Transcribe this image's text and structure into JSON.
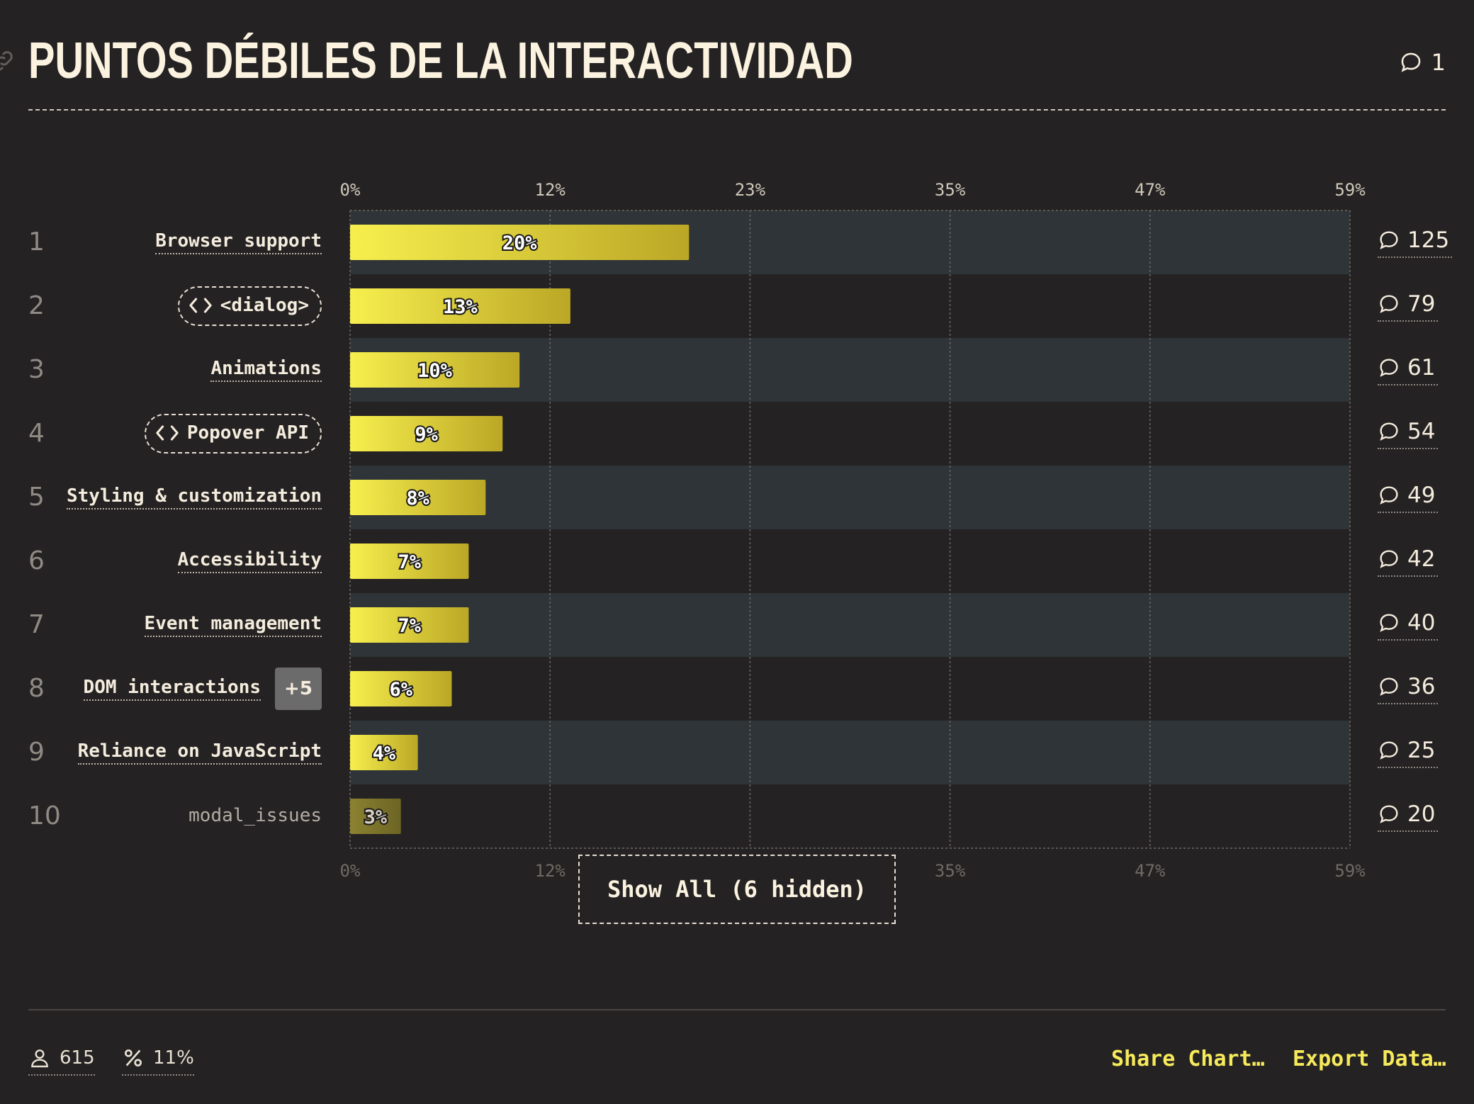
{
  "header": {
    "title": "PUNTOS DÉBILES DE LA INTERACTIVIDAD",
    "comment_count": "1"
  },
  "chart_data": {
    "type": "bar",
    "orientation": "horizontal",
    "categories": [
      "Browser support",
      "<dialog>",
      "Animations",
      "Popover API",
      "Styling & customization",
      "Accessibility",
      "Event management",
      "DOM interactions",
      "Reliance on JavaScript",
      "modal_issues"
    ],
    "values": [
      20,
      13,
      10,
      9,
      8,
      7,
      7,
      6,
      4,
      3
    ],
    "value_labels": [
      "20%",
      "13%",
      "10%",
      "9%",
      "8%",
      "7%",
      "7%",
      "6%",
      "4%",
      "3%"
    ],
    "ranks": [
      "1",
      "2",
      "3",
      "4",
      "5",
      "6",
      "7",
      "8",
      "9",
      "10"
    ],
    "comments": [
      "125",
      "79",
      "61",
      "54",
      "49",
      "42",
      "40",
      "36",
      "25",
      "20"
    ],
    "code_labels": [
      false,
      true,
      false,
      true,
      false,
      false,
      false,
      false,
      false,
      false
    ],
    "muted": [
      false,
      false,
      false,
      false,
      false,
      false,
      false,
      false,
      false,
      true
    ],
    "extra_badges": [
      "",
      "",
      "",
      "",
      "",
      "",
      "",
      "+5",
      "",
      ""
    ],
    "x_ticks": [
      "0%",
      "12%",
      "23%",
      "35%",
      "47%",
      "59%"
    ],
    "xlim": [
      0,
      59
    ],
    "grid": true,
    "bar_color_start": "#f7ef4e",
    "bar_color_end": "#bba726",
    "muted_bar_color_start": "#8b8231",
    "muted_bar_color_end": "#6c6424"
  },
  "show_all_label": "Show All (6 hidden)",
  "footer": {
    "respondents": "615",
    "percent": "11%",
    "share_label": "Share Chart…",
    "export_label": "Export Data…"
  },
  "colors": {
    "background": "#252223",
    "stripe": "#2e3437",
    "accent": "#f6ea5a"
  }
}
